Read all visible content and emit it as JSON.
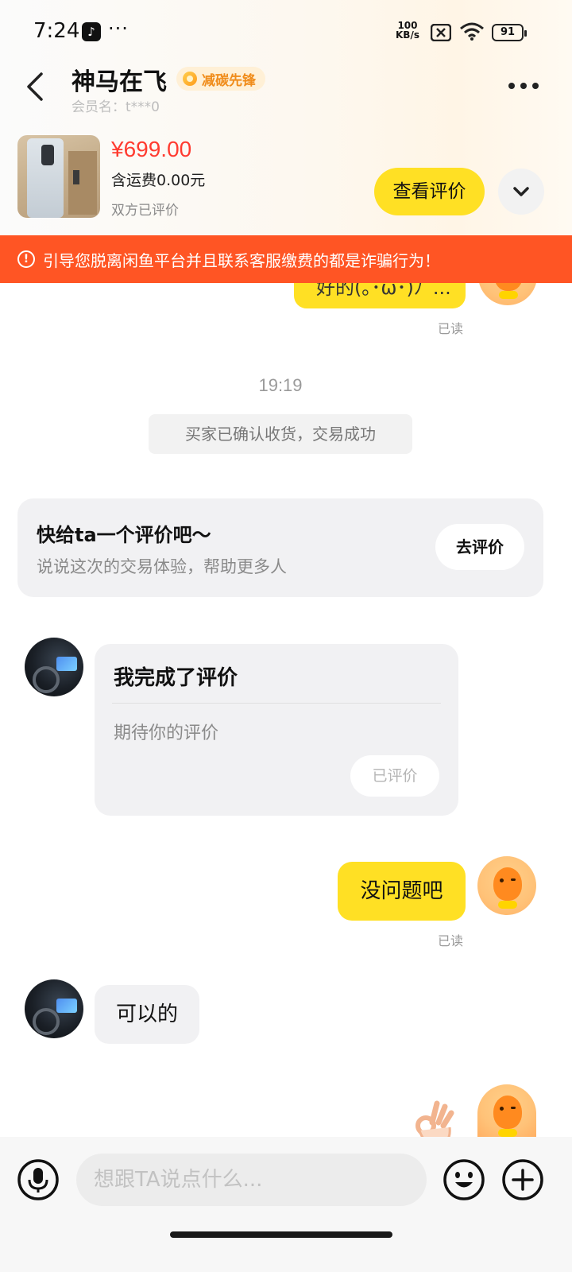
{
  "status_bar": {
    "time": "7:24",
    "app_icon_glyph": "♪",
    "more": "···",
    "speed_value": "100",
    "speed_unit": "KB/s",
    "battery": "91"
  },
  "header": {
    "seller_name": "神马在飞",
    "badge_label": "减碳先锋",
    "member_name": "会员名：t***0"
  },
  "product": {
    "price": "¥699.00",
    "shipping": "含运费0.00元",
    "review_status": "双方已评价",
    "view_review_label": "查看评价"
  },
  "warning": {
    "text": "引导您脱离闲鱼平台并且联系客服缴费的都是诈骗行为！"
  },
  "chat": {
    "partial_message": "好的(｡･ω･)ﾉﾞ...",
    "read_label_1": "已读",
    "timestamp": "19:19",
    "system_message": "买家已确认收货，交易成功",
    "prompt_card": {
      "title": "快给ta一个评价吧～",
      "subtitle": "说说这次的交易体验，帮助更多人",
      "button_label": "去评价"
    },
    "review_card": {
      "title": "我完成了评价",
      "body": "期待你的评价",
      "button_label": "已评价"
    },
    "my_message": "没问题吧",
    "read_label_2": "已读",
    "other_message": "可以的"
  },
  "input_bar": {
    "placeholder": "想跟TA说点什么..."
  },
  "colors": {
    "accent_yellow": "#ffe024",
    "warning_red": "#ff5524",
    "price_red": "#ff3b30"
  }
}
